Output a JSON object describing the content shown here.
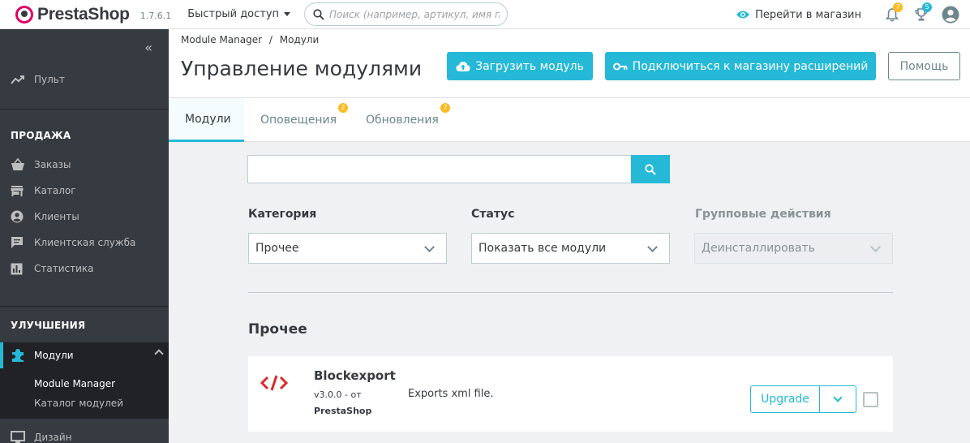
{
  "header": {
    "brand": "PrestaShop",
    "version": "1.7.6.1",
    "quick_access": "Быстрый доступ",
    "search_placeholder": "Поиск (например, артикул, имя поль:",
    "view_shop": "Перейти в магазин",
    "notifications_count": "7",
    "trophy_count": "5"
  },
  "sidebar": {
    "collapse_icon": "double-chevron-left-icon",
    "dashboard": "Пульт",
    "section_sell": "ПРОДАЖА",
    "sell_items": [
      {
        "label": "Заказы",
        "icon": "basket-icon"
      },
      {
        "label": "Каталог",
        "icon": "store-icon"
      },
      {
        "label": "Клиенты",
        "icon": "account-icon"
      },
      {
        "label": "Клиентская служба",
        "icon": "chat-icon"
      },
      {
        "label": "Статистика",
        "icon": "stats-icon"
      }
    ],
    "section_improve": "УЛУЧШЕНИЯ",
    "modules": "Модули",
    "sub_items": [
      "Module Manager",
      "Каталог модулей"
    ],
    "design": "Дизайн"
  },
  "pagehead": {
    "breadcrumb_1": "Module Manager",
    "breadcrumb_sep": "/",
    "breadcrumb_2": "Модули",
    "title": "Управление модулями",
    "upload_btn": "Загрузить модуль",
    "connect_btn": "Подключиться к магазину расширений",
    "help_btn": "Помощь"
  },
  "tabs": [
    {
      "label": "Модули",
      "badge": ""
    },
    {
      "label": "Оповещения",
      "badge": "2"
    },
    {
      "label": "Обновления",
      "badge": "7"
    }
  ],
  "filters": {
    "category_label": "Категория",
    "category_value": "Прочее",
    "status_label": "Статус",
    "status_value": "Показать все модули",
    "bulk_label": "Групповые действия",
    "bulk_value": "Деинсталлировать"
  },
  "category_title": "Прочее",
  "module": {
    "name": "Blockexport",
    "version": "v3.0.0 - от",
    "author": "PrestaShop",
    "description": "Exports xml file.",
    "action": "Upgrade"
  },
  "colors": {
    "accent": "#25b9d7",
    "sidebar": "#363a41",
    "badge": "#fbbb22",
    "brand": "#df0067"
  }
}
